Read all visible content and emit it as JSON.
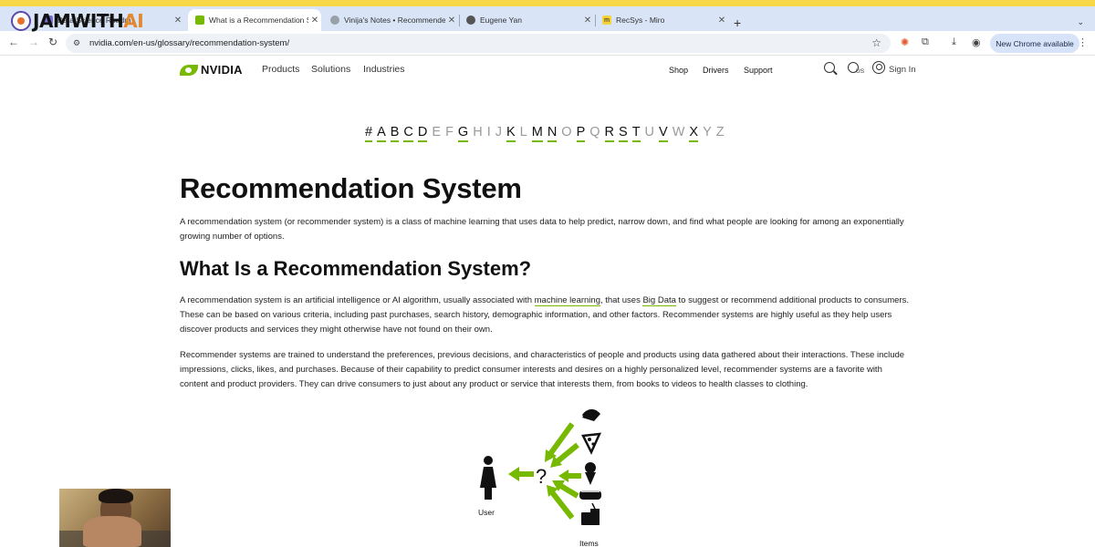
{
  "browser": {
    "tabs": [
      {
        "label": "Data Science Roadm",
        "favicon": "roadmap-icon",
        "active": false
      },
      {
        "label": "What is a Recommendation S",
        "favicon": "nvidia-icon",
        "active": true
      },
      {
        "label": "Vinija's Notes • Recommende",
        "favicon": "globe-icon",
        "active": false
      },
      {
        "label": "Eugene Yan",
        "favicon": "eugene-icon",
        "active": false
      },
      {
        "label": "RecSys - Miro",
        "favicon": "miro-icon",
        "active": false
      }
    ],
    "url": "nvidia.com/en-us/glossary/recommendation-system/",
    "update_button": "New Chrome available"
  },
  "overlay_logo": {
    "part1": "JAM",
    "part2": "WITH",
    "part3": "AI"
  },
  "site_nav": {
    "brand": "NVIDIA",
    "left_links": [
      "Products",
      "Solutions",
      "Industries"
    ],
    "right_links": [
      "Shop",
      "Drivers",
      "Support"
    ],
    "region": "US",
    "signin": "Sign In"
  },
  "alphabet": [
    {
      "ch": "#",
      "on": true
    },
    {
      "ch": "A",
      "on": true
    },
    {
      "ch": "B",
      "on": true
    },
    {
      "ch": "C",
      "on": true
    },
    {
      "ch": "D",
      "on": true
    },
    {
      "ch": "E",
      "on": false
    },
    {
      "ch": "F",
      "on": false
    },
    {
      "ch": "G",
      "on": true
    },
    {
      "ch": "H",
      "on": false
    },
    {
      "ch": "I",
      "on": false
    },
    {
      "ch": "J",
      "on": false
    },
    {
      "ch": "K",
      "on": true
    },
    {
      "ch": "L",
      "on": false
    },
    {
      "ch": "M",
      "on": true
    },
    {
      "ch": "N",
      "on": true
    },
    {
      "ch": "O",
      "on": false
    },
    {
      "ch": "P",
      "on": true
    },
    {
      "ch": "Q",
      "on": false
    },
    {
      "ch": "R",
      "on": true
    },
    {
      "ch": "S",
      "on": true
    },
    {
      "ch": "T",
      "on": true
    },
    {
      "ch": "U",
      "on": false
    },
    {
      "ch": "V",
      "on": true
    },
    {
      "ch": "W",
      "on": false
    },
    {
      "ch": "X",
      "on": true
    },
    {
      "ch": "Y",
      "on": false
    },
    {
      "ch": "Z",
      "on": false
    }
  ],
  "article": {
    "title": "Recommendation System",
    "intro": "A recommendation system (or recommender system) is a class of machine learning that uses data to help predict, narrow down, and find what people are looking for among an exponentially growing number of options.",
    "subheading": "What Is a Recommendation System?",
    "p1_a": "A recommendation system is an artificial intelligence or AI algorithm, usually associated with ",
    "p1_link1": "machine learning",
    "p1_b": ", that uses ",
    "p1_link2": "Big Data",
    "p1_c": " to suggest or recommend additional products to consumers. These can be based on various criteria, including past purchases, search history, demographic information, and other factors. Recommender systems are highly useful as they help users discover products and services they might otherwise have not found on their own.",
    "p2": "Recommender systems are trained to understand the preferences, previous decisions, and characteristics of people and products using data gathered about their interactions. These include impressions, clicks, likes, and purchases. Because of their capability to predict consumer interests and desires on a highly personalized level, recommender systems are a favorite with content and product providers. They can drive consumers to just about any product or service that interests them, from books to videos to health classes to clothing."
  },
  "diagram": {
    "user_label": "User",
    "items_label": "Items",
    "question": "?",
    "arrow_color": "#76b900",
    "item_icons": [
      "taco-icon",
      "pizza-icon",
      "ice-cream-icon",
      "sushi-icon",
      "fast-food-icon"
    ]
  },
  "colors": {
    "accent": "#76b900",
    "tabbar": "#d9e5f7",
    "top_strip": "#f8d847"
  }
}
